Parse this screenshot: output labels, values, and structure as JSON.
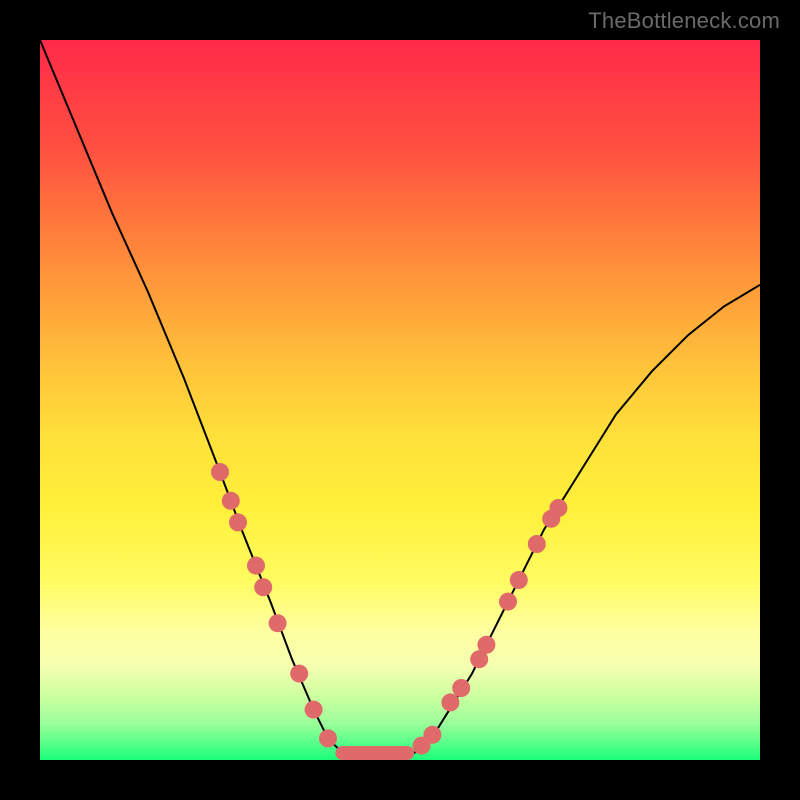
{
  "watermark": "TheBottleneck.com",
  "chart_data": {
    "type": "line",
    "title": "",
    "xlabel": "",
    "ylabel": "",
    "xlim": [
      0,
      100
    ],
    "ylim": [
      0,
      100
    ],
    "series": [
      {
        "name": "curve",
        "x": [
          0,
          5,
          10,
          15,
          20,
          25,
          28,
          30,
          32,
          35,
          38,
          40,
          42,
          44,
          46,
          48,
          50,
          52,
          55,
          60,
          65,
          70,
          75,
          80,
          85,
          90,
          95,
          100
        ],
        "values": [
          100,
          88,
          76,
          65,
          53,
          40,
          32,
          27,
          22,
          14,
          7,
          3,
          1,
          0,
          0,
          0,
          0,
          1,
          4,
          12,
          22,
          32,
          40,
          48,
          54,
          59,
          63,
          66
        ]
      }
    ],
    "flat_segment": {
      "x_start": 42,
      "x_end": 51,
      "y": 0
    },
    "dots": [
      {
        "x": 25.0,
        "y": 40.0
      },
      {
        "x": 26.5,
        "y": 36.0
      },
      {
        "x": 27.5,
        "y": 33.0
      },
      {
        "x": 30.0,
        "y": 27.0
      },
      {
        "x": 31.0,
        "y": 24.0
      },
      {
        "x": 33.0,
        "y": 19.0
      },
      {
        "x": 36.0,
        "y": 12.0
      },
      {
        "x": 38.0,
        "y": 7.0
      },
      {
        "x": 40.0,
        "y": 3.0
      },
      {
        "x": 53.0,
        "y": 2.0
      },
      {
        "x": 54.5,
        "y": 3.5
      },
      {
        "x": 57.0,
        "y": 8.0
      },
      {
        "x": 58.5,
        "y": 10.0
      },
      {
        "x": 61.0,
        "y": 14.0
      },
      {
        "x": 62.0,
        "y": 16.0
      },
      {
        "x": 65.0,
        "y": 22.0
      },
      {
        "x": 66.5,
        "y": 25.0
      },
      {
        "x": 69.0,
        "y": 30.0
      },
      {
        "x": 71.0,
        "y": 33.5
      },
      {
        "x": 72.0,
        "y": 35.0
      }
    ]
  }
}
